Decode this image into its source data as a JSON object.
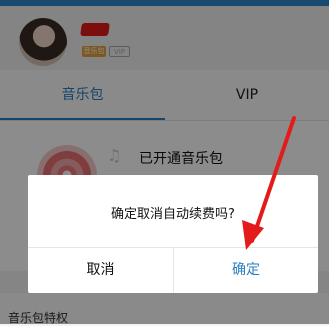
{
  "profile": {
    "badge_music": "音乐包",
    "badge_vip": "VIP"
  },
  "tabs": [
    {
      "label": "音乐包"
    },
    {
      "label": "VIP"
    }
  ],
  "package": {
    "title": "已开通音乐包"
  },
  "dialog": {
    "message": "确定取消自动续费吗?",
    "cancel_label": "取消",
    "confirm_label": "确定"
  },
  "bottom": {
    "label": "音乐包特权"
  },
  "colors": {
    "accent": "#2b7fc1",
    "annotation_arrow": "#e31b1b"
  }
}
